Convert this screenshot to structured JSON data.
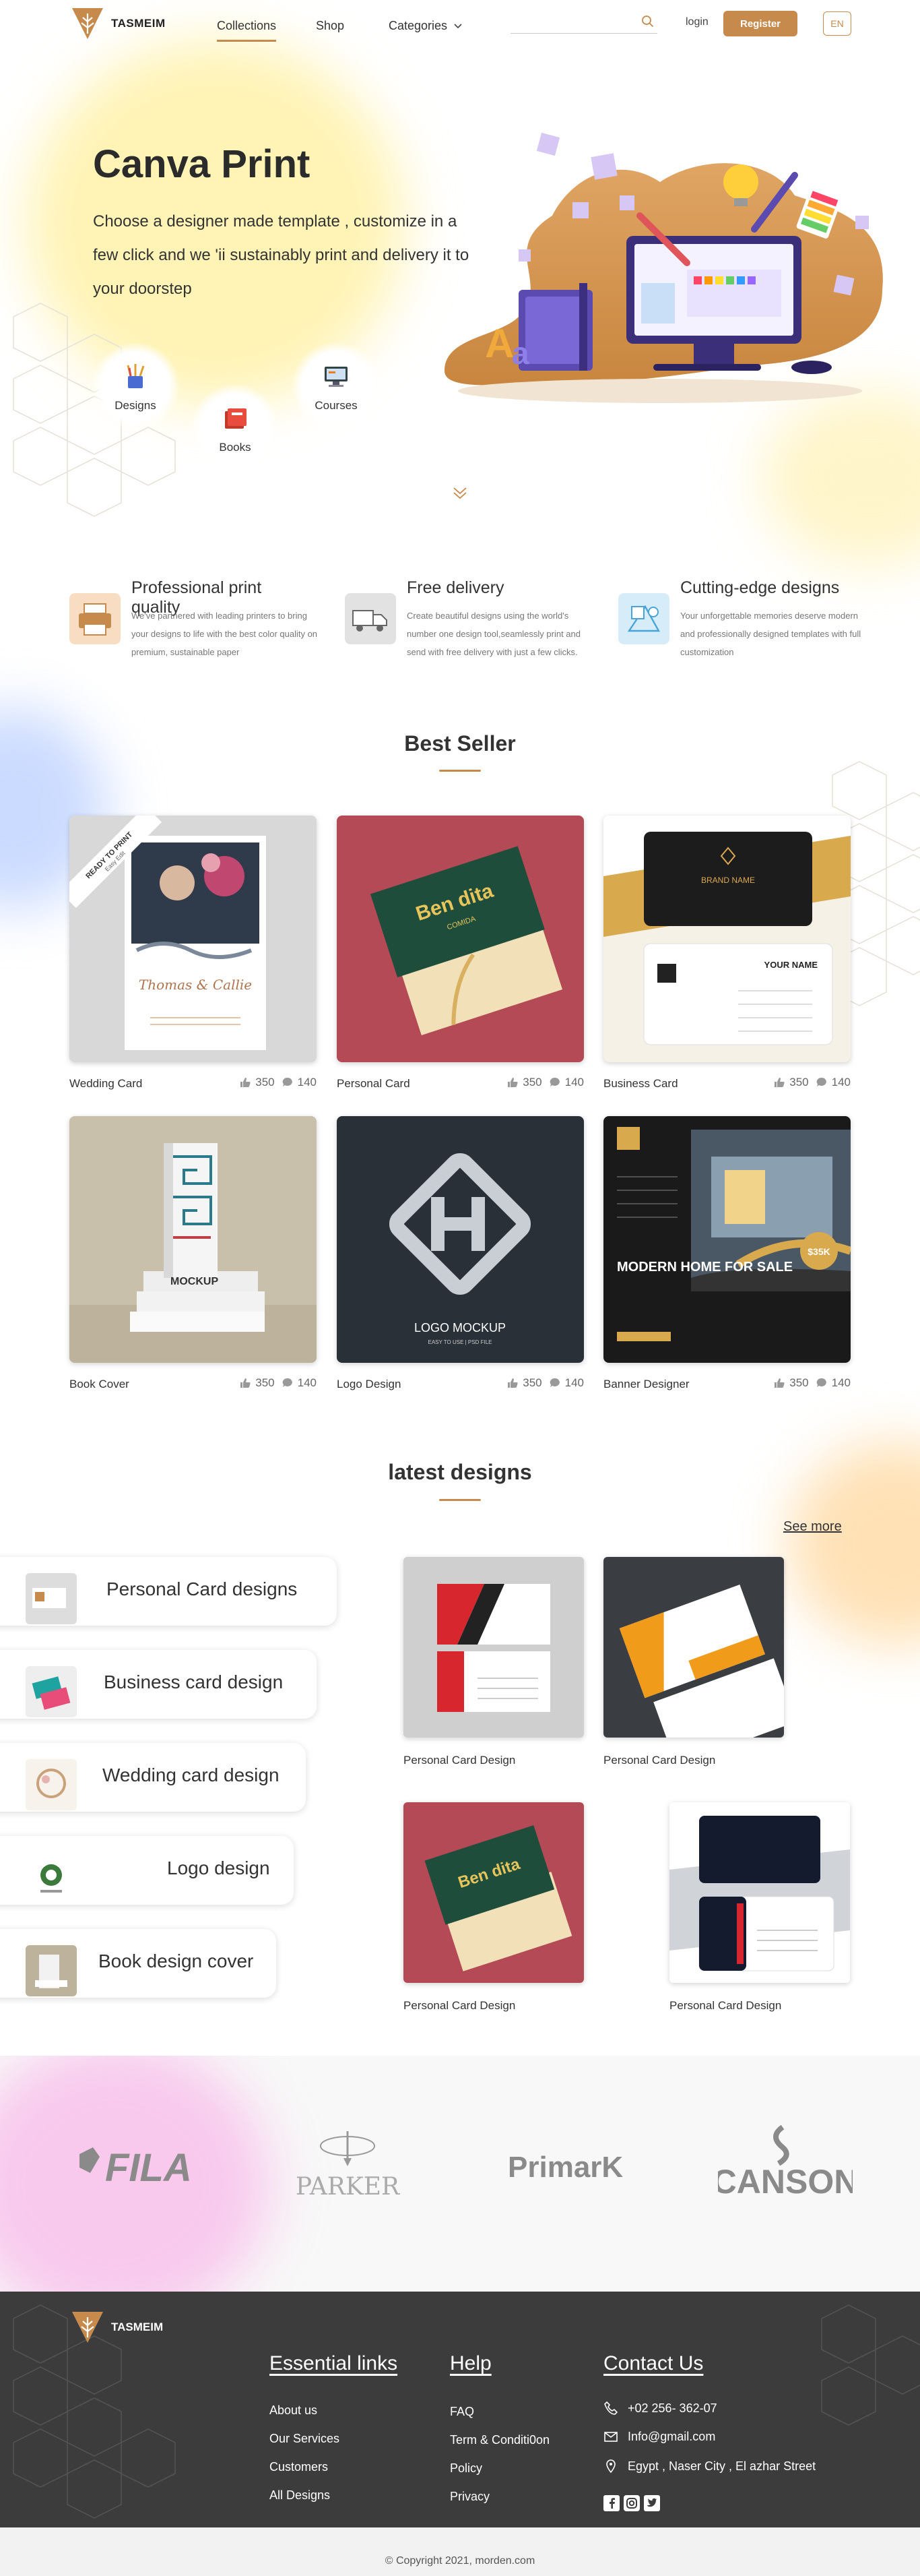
{
  "brand": {
    "name": "TASMEIM"
  },
  "nav": {
    "items": [
      {
        "label": "Collections",
        "active": true
      },
      {
        "label": "Shop"
      },
      {
        "label": "Categories"
      }
    ],
    "search_placeholder": "",
    "login": "login",
    "register": "Register",
    "language": "EN"
  },
  "hero": {
    "title": "Canva Print",
    "text": "Choose a designer made template , customize in a few click and we 'ii sustainably print and delivery it to your doorstep",
    "categories": [
      {
        "label": "Designs",
        "icon": "pencil-cup-icon"
      },
      {
        "label": "Books",
        "icon": "book-icon"
      },
      {
        "label": "Courses",
        "icon": "monitor-icon"
      }
    ]
  },
  "features": [
    {
      "title": "Professional print quality",
      "text": "We've partnered with leading printers to bring your designs to life with the best color quality on premium, sustainable paper",
      "icon": "printer-icon"
    },
    {
      "title": "Free delivery",
      "text": "Create beautiful designs using the world's number one design tool,seamlessly print and send with free delivery with just a few clicks.",
      "icon": "delivery-truck-icon"
    },
    {
      "title": "Cutting-edge designs",
      "text": "Your unforgettable memories deserve modern and professionally designed templates with full customization",
      "icon": "palette-icon"
    }
  ],
  "best_seller": {
    "title": "Best Seller",
    "items": [
      {
        "name": "Wedding Card",
        "likes": "350",
        "comments": "140",
        "ribbon": "READY TO PRINT",
        "ribbon_sub": "Easy Edit",
        "card_text": "Thomas & Callie"
      },
      {
        "name": "Personal Card",
        "likes": "350",
        "comments": "140",
        "card_text": "Ben dita",
        "card_sub": "COMIDA"
      },
      {
        "name": "Business Card",
        "likes": "350",
        "comments": "140",
        "card_text": "BRAND NAME",
        "card_sub": "YOUR NAME"
      },
      {
        "name": "Book Cover",
        "likes": "350",
        "comments": "140",
        "card_text": "MOCKUP"
      },
      {
        "name": "Logo Design",
        "likes": "350",
        "comments": "140",
        "card_text": "LOGO MOCKUP",
        "card_sub": "EASY TO USE | PSD FILE"
      },
      {
        "name": "Banner Designer",
        "likes": "350",
        "comments": "140",
        "card_text": "MODERN HOME FOR SALE",
        "card_sub": "$35K"
      }
    ]
  },
  "latest": {
    "title": "latest designs",
    "see_more": "See more",
    "categories": [
      {
        "label": "Personal Card designs"
      },
      {
        "label": "Business card design"
      },
      {
        "label": "Wedding card design"
      },
      {
        "label": "Logo design"
      },
      {
        "label": "Book design cover"
      }
    ],
    "items": [
      {
        "name": "Personal Card Design"
      },
      {
        "name": "Personal Card Design"
      },
      {
        "name": "Personal Card Design"
      },
      {
        "name": "Personal Card Design"
      }
    ]
  },
  "brands": [
    "FILA",
    "PARKER",
    "PrimarK",
    "CANSON"
  ],
  "footer": {
    "brand": "TASMEIM",
    "essential": {
      "title": "Essential links",
      "links": [
        "About us",
        "Our Services",
        "Customers",
        "All Designs"
      ]
    },
    "help": {
      "title": "Help",
      "links": [
        "FAQ",
        "Term & Conditi0on",
        "Policy",
        "Privacy"
      ]
    },
    "contact": {
      "title": "Contact Us",
      "phone": "+02 256- 362-07",
      "email": "Info@gmail.com",
      "address": "Egypt , Naser City , El azhar Street"
    },
    "copyright": "© Copyright 2021, morden.com"
  },
  "colors": {
    "accent": "#c68a4c",
    "footer_bg": "#3c3c3c",
    "text": "#333333"
  }
}
